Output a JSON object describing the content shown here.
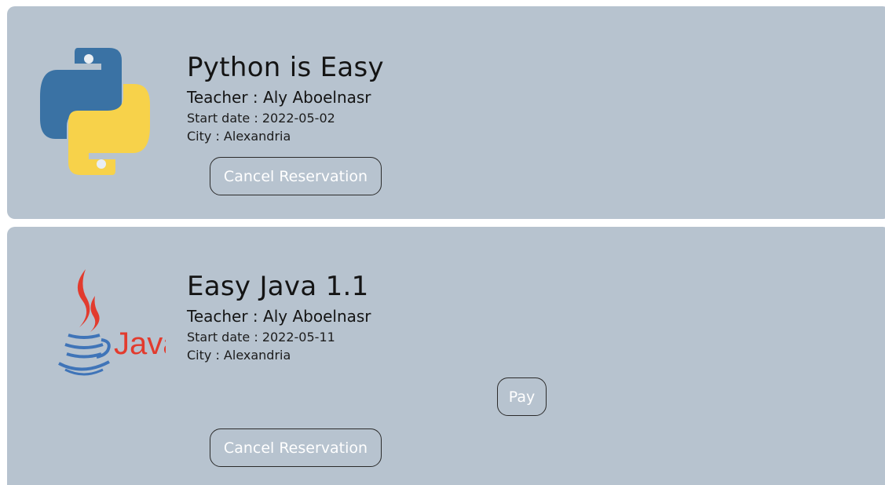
{
  "courses": [
    {
      "logo": "python-logo",
      "title": "Python is Easy",
      "teacher": "Teacher : Aly Aboelnasr",
      "start_date": "Start date : 2022-05-02",
      "city": "City : Alexandria",
      "cancel_label": "Cancel Reservation"
    },
    {
      "logo": "java-logo",
      "logo_text": "Java",
      "title": "Easy Java 1.1",
      "teacher": "Teacher : Aly Aboelnasr",
      "start_date": "Start date : 2022-05-11",
      "city": "City : Alexandria",
      "pay_label": "Pay",
      "cancel_label": "Cancel Reservation"
    }
  ],
  "colors": {
    "card_background": "#b7c3cf",
    "python_blue": "#3a72a4",
    "python_yellow": "#f7d24a",
    "java_red": "#e23b2e",
    "java_blue": "#3f74b8",
    "button_text": "#ffffff"
  }
}
